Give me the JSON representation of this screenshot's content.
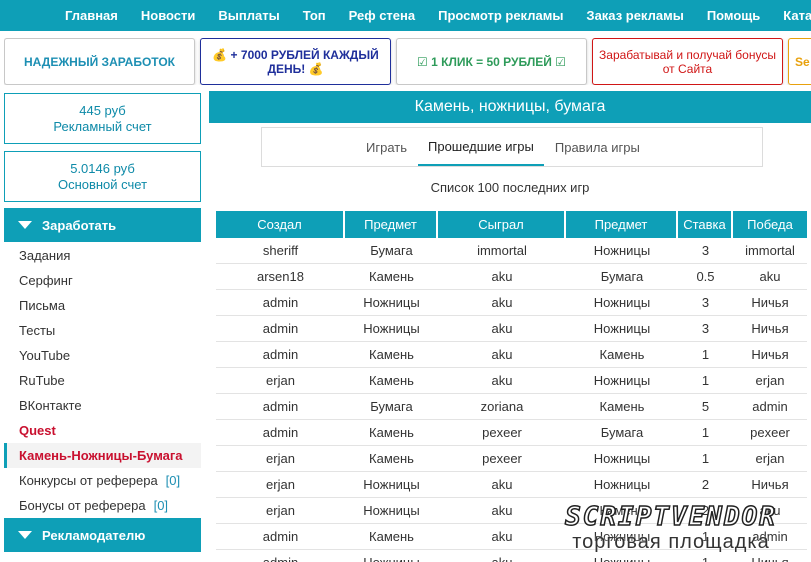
{
  "nav": {
    "items": [
      {
        "label": "Главная"
      },
      {
        "label": "Новости"
      },
      {
        "label": "Выплаты"
      },
      {
        "label": "Топ"
      },
      {
        "label": "Реф стена"
      },
      {
        "label": "Просмотр рекламы"
      },
      {
        "label": "Заказ рекламы"
      },
      {
        "label": "Помощь"
      },
      {
        "label": "Каталог сайтов"
      }
    ]
  },
  "banners": [
    {
      "text": "НАДЕЖНЫЙ ЗАРАБОТОК"
    },
    {
      "text": "💰 + 7000 РУБЛЕЙ КАЖДЫЙ ДЕНЬ! 💰"
    },
    {
      "text": "☑ 1 КЛИК = 50 РУБЛЕЙ ☑"
    },
    {
      "text": "Зарабатывай и получай бонусы от Сайта"
    },
    {
      "text": "Se"
    }
  ],
  "accounts": {
    "ad": {
      "amount": "445 руб",
      "label": "Рекламный счет"
    },
    "main": {
      "amount": "5.0146 руб",
      "label": "Основной счет"
    }
  },
  "menu": {
    "earn_title": "Заработать",
    "advertiser_title": "Рекламодателю",
    "items": [
      {
        "label": "Задания"
      },
      {
        "label": "Серфинг"
      },
      {
        "label": "Письма"
      },
      {
        "label": "Тесты"
      },
      {
        "label": "YouTube"
      },
      {
        "label": "RuTube"
      },
      {
        "label": "ВКонтакте"
      },
      {
        "label": "Quest"
      },
      {
        "label": "Камень-Ножницы-Бумага"
      },
      {
        "label": "Конкурсы от реферера",
        "count": "[0]"
      },
      {
        "label": "Бонусы от реферера",
        "count": "[0]"
      }
    ]
  },
  "main": {
    "title": "Камень, ножницы, бумага",
    "tabs": [
      {
        "label": "Играть"
      },
      {
        "label": "Прошедшие игры"
      },
      {
        "label": "Правила игры"
      }
    ],
    "subtitle": "Список 100 последних игр",
    "table": {
      "headers": [
        "Создал",
        "Предмет",
        "Сыграл",
        "Предмет",
        "Ставка",
        "Победа"
      ],
      "rows": [
        [
          "sheriff",
          "Бумага",
          "immortal",
          "Ножницы",
          "3",
          "immortal"
        ],
        [
          "arsen18",
          "Камень",
          "aku",
          "Бумага",
          "0.5",
          "aku"
        ],
        [
          "admin",
          "Ножницы",
          "aku",
          "Ножницы",
          "3",
          "Ничья"
        ],
        [
          "admin",
          "Ножницы",
          "aku",
          "Ножницы",
          "3",
          "Ничья"
        ],
        [
          "admin",
          "Камень",
          "aku",
          "Камень",
          "1",
          "Ничья"
        ],
        [
          "erjan",
          "Камень",
          "aku",
          "Ножницы",
          "1",
          "erjan"
        ],
        [
          "admin",
          "Бумага",
          "zoriana",
          "Камень",
          "5",
          "admin"
        ],
        [
          "admin",
          "Камень",
          "pexeer",
          "Бумага",
          "1",
          "pexeer"
        ],
        [
          "erjan",
          "Камень",
          "pexeer",
          "Ножницы",
          "1",
          "erjan"
        ],
        [
          "erjan",
          "Ножницы",
          "aku",
          "Ножницы",
          "2",
          "Ничья"
        ],
        [
          "erjan",
          "Ножницы",
          "aku",
          "Камень",
          "2",
          "aku"
        ],
        [
          "admin",
          "Камень",
          "aku",
          "Ножницы",
          "1",
          "admin"
        ],
        [
          "admin",
          "Ножницы",
          "aku",
          "Ножницы",
          "1",
          "Ничья"
        ]
      ]
    }
  },
  "watermark": {
    "line1": "SCRIPTVENDOR",
    "line2": "торговая площадка"
  }
}
